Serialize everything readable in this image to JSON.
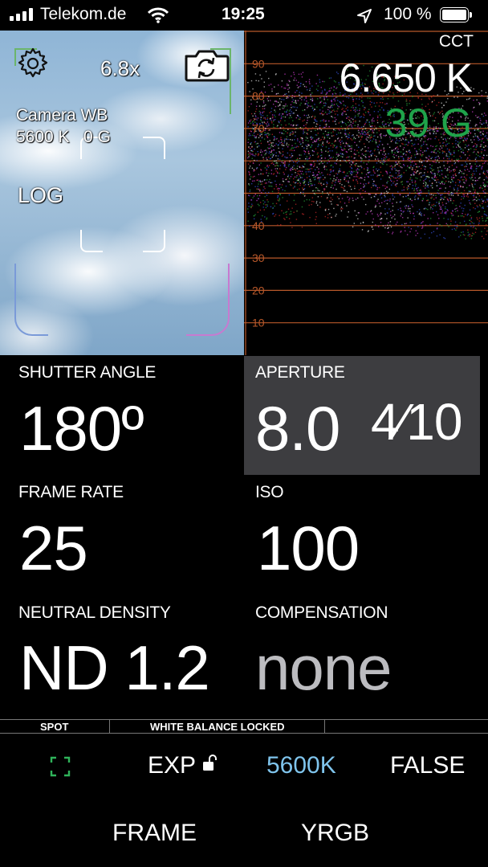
{
  "status_bar": {
    "carrier": "Telekom.de",
    "time": "19:25",
    "battery": "100 %"
  },
  "preview": {
    "zoom": "6.8x",
    "wb_title": "Camera WB",
    "wb_value": "5600 K   0 G",
    "mode": "LOG"
  },
  "waveform": {
    "cct_label": "CCT",
    "cct_value": "6.650 K",
    "tint_value": "39 G",
    "scale": [
      "90",
      "80",
      "70",
      "40",
      "30",
      "20",
      "10"
    ],
    "colors": {
      "line": "#b8582a",
      "tint": "#1fa34a"
    }
  },
  "readouts": {
    "shutter_label": "SHUTTER ANGLE",
    "shutter_value": "180º",
    "aperture_label": "APERTURE",
    "aperture_value": "8.0",
    "aperture_fraction": "4⁄10",
    "framerate_label": "FRAME RATE",
    "framerate_value": "25",
    "iso_label": "ISO",
    "iso_value": "100",
    "nd_label": "NEUTRAL DENSITY",
    "nd_value": "ND 1.2",
    "comp_label": "COMPENSATION",
    "comp_value": "none"
  },
  "strip": {
    "spot": "SPOT",
    "wb_locked": "WHITE BALANCE LOCKED"
  },
  "controls": {
    "exp": "EXP",
    "wb": "5600K",
    "false_color": "FALSE",
    "frame": "FRAME",
    "yrgb": "YRGB",
    "colors": {
      "wb": "#7fc4ec",
      "focus": "#2fb35a"
    }
  }
}
